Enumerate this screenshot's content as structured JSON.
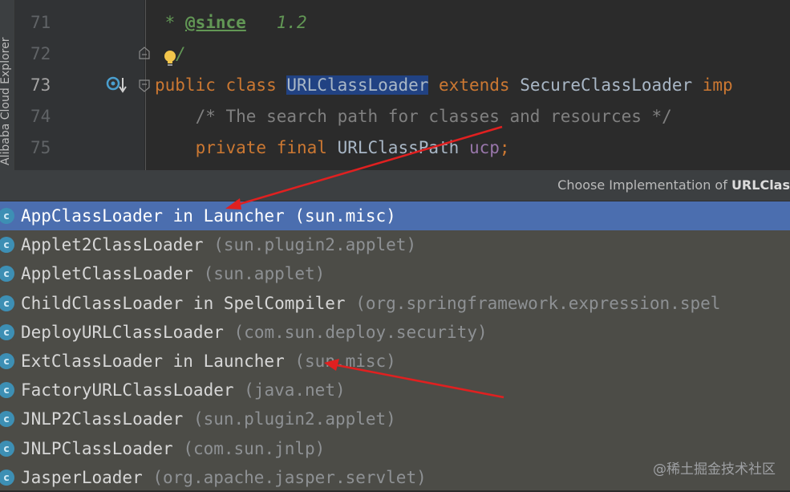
{
  "sidebar": {
    "label": "Alibaba Cloud Explorer"
  },
  "editor": {
    "line_numbers": [
      "71",
      "72",
      "73",
      "74",
      "75"
    ],
    "line71": {
      "star": " * ",
      "tag": "@since",
      "rest": "   1.2"
    },
    "line72": {
      "text": "/"
    },
    "line73": {
      "kw1": "public class ",
      "selected": "URLClassLoader",
      "kw2": " extends ",
      "super": "SecureClassLoader ",
      "kw3": "imp"
    },
    "line74": {
      "indent": "    ",
      "comment": "/* The search path for classes and resources */"
    },
    "line75": {
      "indent": "    ",
      "kw": "private final ",
      "type": "URLClassPath ",
      "field": "ucp",
      "semi": ";"
    },
    "icons": {
      "bulb": "lightbulb-icon",
      "implemented": "implemented-by-icon",
      "fold": "fold-icon"
    }
  },
  "popup": {
    "title_prefix": "Choose Implementation of ",
    "title_bold": "URLClas",
    "items": [
      {
        "name": "AppClassLoader in Launcher",
        "package": "(sun.misc)",
        "selected": true
      },
      {
        "name": "Applet2ClassLoader",
        "package": "(sun.plugin2.applet)"
      },
      {
        "name": "AppletClassLoader",
        "package": "(sun.applet)"
      },
      {
        "name": "ChildClassLoader in SpelCompiler",
        "package": "(org.springframework.expression.spel"
      },
      {
        "name": "DeployURLClassLoader",
        "package": "(com.sun.deploy.security)"
      },
      {
        "name": "ExtClassLoader in Launcher",
        "package": "(sun.misc)"
      },
      {
        "name": "FactoryURLClassLoader",
        "package": "(java.net)"
      },
      {
        "name": "JNLP2ClassLoader",
        "package": "(sun.plugin2.applet)"
      },
      {
        "name": "JNLPClassLoader",
        "package": "(com.sun.jnlp)"
      },
      {
        "name": "JasperLoader",
        "package": "(org.apache.jasper.servlet)"
      }
    ],
    "class_icon_letter": "c"
  },
  "watermark": "@稀土掘金技术社区",
  "colors": {
    "accent_selected": "#4b6eaf",
    "annotation_arrow": "#e02020"
  }
}
